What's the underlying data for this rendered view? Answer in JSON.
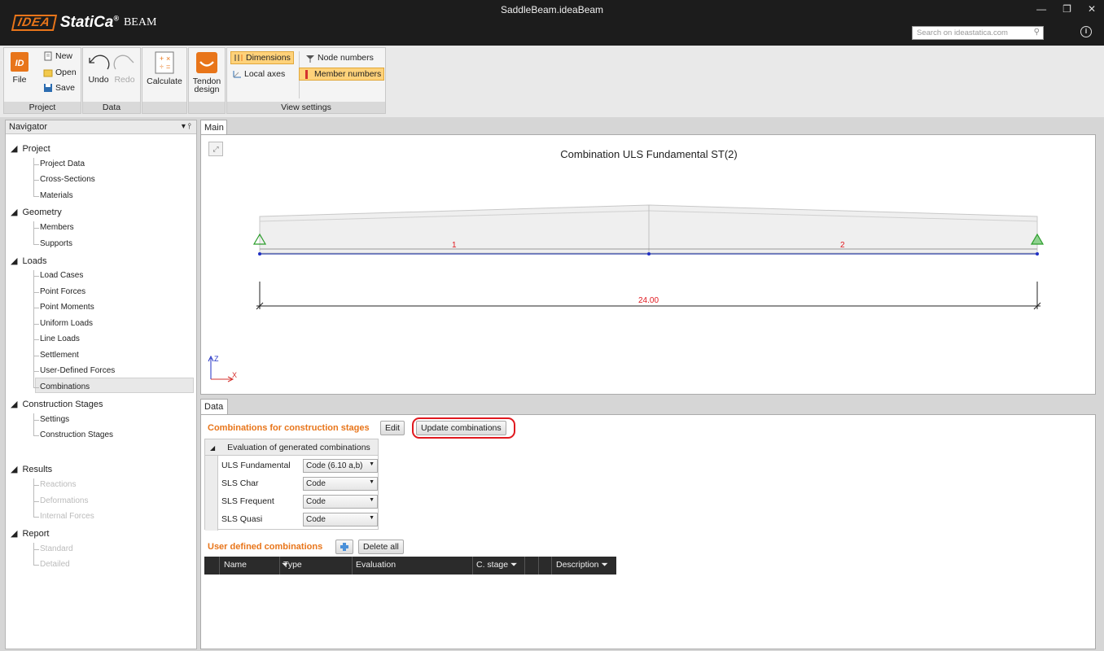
{
  "app": {
    "window_title": "SaddleBeam.ideaBeam",
    "logo_idea": "IDEA",
    "logo_statica": "StatiCa",
    "logo_reg": "®",
    "logo_product": "BEAM",
    "search_placeholder": "Search on ideastatica.com",
    "win_minimize": "—",
    "win_restore": "❐",
    "win_close": "✕",
    "info_icon": "i"
  },
  "ribbon": {
    "project_group": "Project",
    "data_group": "Data",
    "view_group": "View settings",
    "file": "File",
    "new": "New",
    "open": "Open",
    "save": "Save",
    "undo": "Undo",
    "redo": "Redo",
    "calculate": "Calculate",
    "tendon_1": "Tendon",
    "tendon_2": "design",
    "dimensions": "Dimensions",
    "local_axes": "Local axes",
    "node_numbers": "Node numbers",
    "member_numbers": "Member numbers"
  },
  "navigator": {
    "title": "Navigator",
    "pin": "▾  ⫯",
    "sections": [
      {
        "label": "Project",
        "items": [
          "Project Data",
          "Cross-Sections",
          "Materials"
        ]
      },
      {
        "label": "Geometry",
        "items": [
          "Members",
          "Supports"
        ]
      },
      {
        "label": "Loads",
        "items": [
          "Load Cases",
          "Point Forces",
          "Point Moments",
          "Uniform Loads",
          "Line Loads",
          "Settlement",
          "User-Defined Forces",
          "Combinations"
        ]
      },
      {
        "label": "Construction Stages",
        "items": [
          "Settings",
          "Construction Stages"
        ]
      },
      {
        "label": "Results",
        "items": [
          "Reactions",
          "Deformations",
          "Internal Forces"
        ]
      },
      {
        "label": "Report",
        "items": [
          "Standard",
          "Detailed"
        ]
      }
    ]
  },
  "main": {
    "tab": "Main",
    "view_title": "Combination ULS Fundamental ST(2)",
    "member_1": "1",
    "member_2": "2",
    "dimension": "24.00",
    "axis_z": "Z",
    "axis_x": "X"
  },
  "data_panel": {
    "tab": "Data",
    "title": "Combinations for construction stages",
    "edit": "Edit",
    "update": "Update combinations",
    "eval_header": "Evaluation of generated combinations",
    "eval_rows": [
      {
        "label": "ULS Fundamental",
        "value": "Code (6.10 a,b)"
      },
      {
        "label": "SLS Char",
        "value": "Code"
      },
      {
        "label": "SLS Frequent",
        "value": "Code"
      },
      {
        "label": "SLS Quasi",
        "value": "Code"
      }
    ],
    "user_title": "User defined combinations",
    "delete_all": "Delete all",
    "columns": [
      "Name",
      "Type",
      "Evaluation",
      "C. stage",
      "Description"
    ]
  },
  "colors": {
    "accent": "#e8751a",
    "highlight": "#ffd27a",
    "annotation": "#e0191f"
  }
}
